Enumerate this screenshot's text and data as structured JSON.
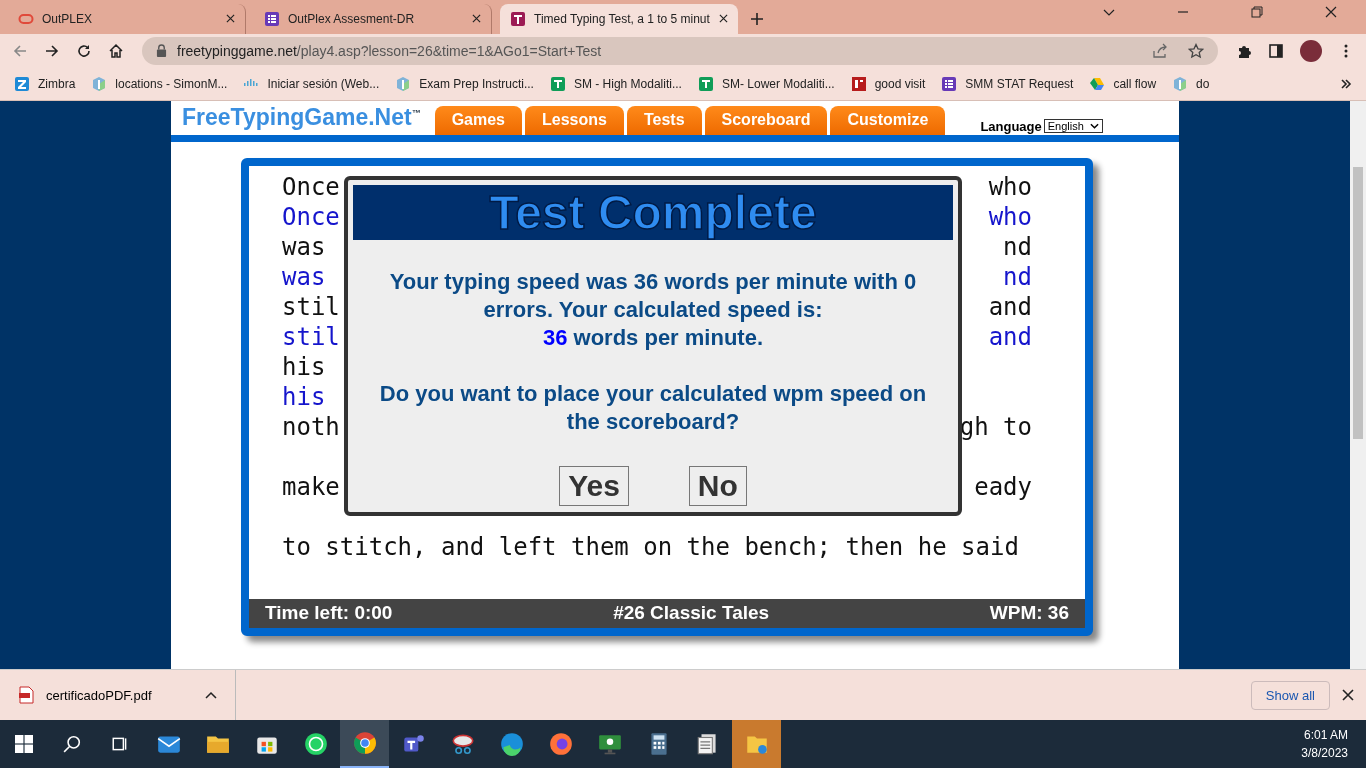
{
  "browser": {
    "tabs": [
      {
        "title": "OutPLEX",
        "selected": false
      },
      {
        "title": "OutPlex Assesment-DR",
        "selected": false
      },
      {
        "title": "Timed Typing Test, a 1 to 5 minut",
        "selected": true
      }
    ],
    "address": {
      "domain": "freetypinggame.net",
      "path": "/play4.asp?lesson=26&time=1&AGo1=Start+Test"
    },
    "bookmarks": [
      {
        "label": "Zimbra"
      },
      {
        "label": "locations - SimonM..."
      },
      {
        "label": "Iniciar sesión (Web..."
      },
      {
        "label": "Exam Prep Instructi..."
      },
      {
        "label": "SM - High Modaliti..."
      },
      {
        "label": "SM- Lower Modaliti..."
      },
      {
        "label": "good visit"
      },
      {
        "label": "SMM STAT Request"
      },
      {
        "label": "call flow"
      },
      {
        "label": "do"
      }
    ]
  },
  "site": {
    "logo": "FreeTypingGame.Net",
    "trademark": "™",
    "nav": [
      {
        "label": "Games"
      },
      {
        "label": "Lessons"
      },
      {
        "label": "Tests"
      },
      {
        "label": "Scoreboard"
      },
      {
        "label": "Customize"
      }
    ],
    "language_label": "Language",
    "language_value": "English"
  },
  "test": {
    "rows": [
      {
        "source": {
          "left": "Once",
          "right": "who"
        },
        "typed": {
          "left": "Once",
          "right": "who"
        }
      },
      {
        "source": {
          "left": "was",
          "right": "nd"
        },
        "typed": {
          "left": "was",
          "right": "nd"
        }
      },
      {
        "source": {
          "left": "stil",
          "right": "and"
        },
        "typed": {
          "left": "stil",
          "right": "and"
        }
      },
      {
        "source": {
          "left": "his"
        },
        "typed": {
          "left": "his"
        }
      },
      {
        "source": {
          "left": "noth",
          "right": "gh to"
        }
      },
      {
        "source": {
          "left": "make",
          "right": "eady"
        }
      },
      {
        "source": {
          "left": "to stitch, and left them on the bench; then he said"
        }
      }
    ],
    "status": {
      "time_left": "Time left: 0:00",
      "lesson": "#26 Classic Tales",
      "wpm": "WPM: 36"
    }
  },
  "dialog": {
    "title": "Test Complete",
    "result": "Your typing speed was 36 words per minute with 0 errors. Your calculated speed is:",
    "speed": "36",
    "speed_unit": "words per minute.",
    "question": "Do you want to place your calculated wpm speed on the scoreboard?",
    "buttons": [
      {
        "label": "Yes"
      },
      {
        "label": "No"
      }
    ]
  },
  "downloads": {
    "file": "certificadoPDF.pdf",
    "show_all": "Show all"
  },
  "taskbar": {
    "time": "6:01 AM",
    "date": "3/8/2023"
  }
}
